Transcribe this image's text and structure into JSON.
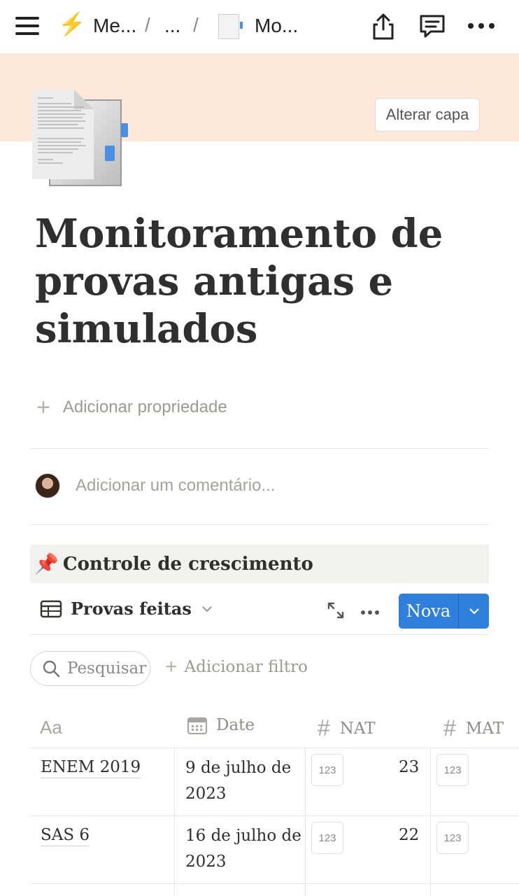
{
  "topbar": {
    "crumb1": "Me...",
    "sep": "/",
    "crumb2": "...",
    "crumb3": "Mo..."
  },
  "cover": {
    "change_label": "Alterar capa"
  },
  "page": {
    "title": "Monitoramento de provas antigas e simulados",
    "add_property": "Adicionar propriedade",
    "comment_placeholder": "Adicionar um comentário..."
  },
  "callout": {
    "emoji": "📌",
    "text": "Controle de crescimento"
  },
  "view": {
    "name": "Provas feitas",
    "new_label": "Nova",
    "search_placeholder": "Pesquisar",
    "add_filter": "Adicionar filtro"
  },
  "table": {
    "columns": {
      "name": "Aa",
      "date": "Date",
      "nat": "NAT",
      "mat": "MAT"
    },
    "number_badge": "123",
    "rows": [
      {
        "name": "ENEM 2019",
        "date": "9 de julho de 2023",
        "nat": "23"
      },
      {
        "name": "SAS 6",
        "date": "16 de julho de 2023",
        "nat": "22"
      }
    ]
  },
  "colors": {
    "accent": "#2f7fdc",
    "cover": "#fde8da"
  }
}
